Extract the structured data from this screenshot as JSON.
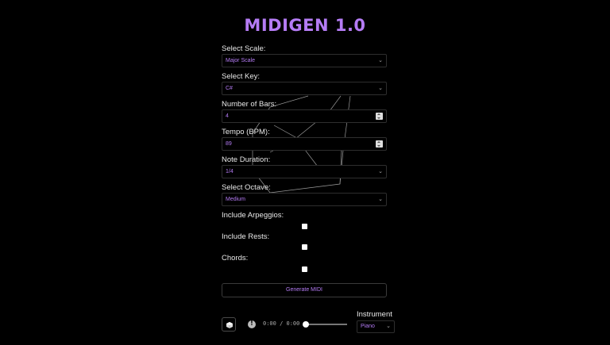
{
  "app": {
    "title": "MIDIGEN 1.0"
  },
  "form": {
    "scale": {
      "label": "Select Scale:",
      "value": "Major Scale"
    },
    "key": {
      "label": "Select Key:",
      "value": "C#"
    },
    "bars": {
      "label": "Number of Bars:",
      "value": "4"
    },
    "tempo": {
      "label": "Tempo (BPM):",
      "value": "89"
    },
    "duration": {
      "label": "Note Duration:",
      "value": "1/4"
    },
    "octave": {
      "label": "Select Octave:",
      "value": "Medium"
    },
    "arpeggios": {
      "label": "Include Arpeggios:",
      "checked": false
    },
    "rests": {
      "label": "Include Rests:",
      "checked": false
    },
    "chords": {
      "label": "Chords:",
      "checked": false
    }
  },
  "actions": {
    "generate_label": "Generate MIDI"
  },
  "player": {
    "time": "0:00 / 0:00",
    "progress": 0
  },
  "instrument": {
    "label": "Instrument",
    "value": "Piano"
  },
  "colors": {
    "accent": "#b57cf5",
    "background": "#000000",
    "text": "#e8e8e8"
  },
  "icons": {
    "play": "cube-icon",
    "status": "warning-icon",
    "dropdown": "chevron-down-icon"
  }
}
